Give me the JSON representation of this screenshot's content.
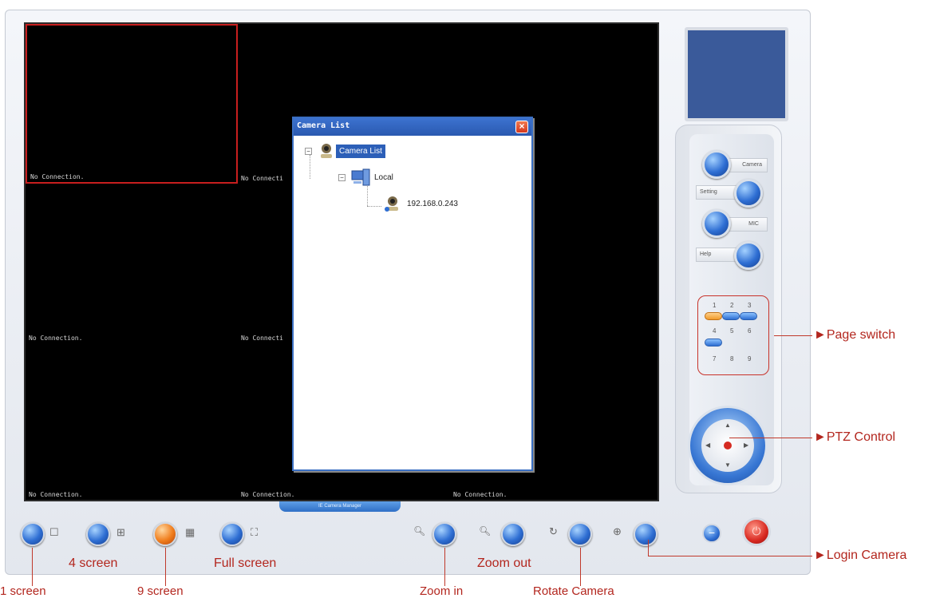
{
  "video": {
    "cells": [
      {
        "text": "No Connection."
      },
      {
        "text": "No Connecti"
      },
      {
        "text": "No Connection."
      },
      {
        "text": "No Connecti"
      },
      {
        "text": "No Connection."
      },
      {
        "text": "No Connection."
      },
      {
        "text": "No Connection."
      }
    ],
    "manager_tab": "IE Camera Manager"
  },
  "dialog": {
    "title": "Camera List",
    "close": "×",
    "tree": {
      "root": "Camera List",
      "group": "Local",
      "device": "192.168.0.243"
    }
  },
  "side_panel": {
    "buttons": [
      {
        "label": "Camera",
        "icon": "camera-button"
      },
      {
        "label": "Setting",
        "icon": "setting-button"
      },
      {
        "label": "MIC",
        "icon": "mic-button"
      },
      {
        "label": "Help",
        "icon": "help-button"
      }
    ],
    "page_numbers": [
      "1",
      "2",
      "3",
      "4",
      "5",
      "6",
      "7",
      "8",
      "9"
    ]
  },
  "toolbar": {
    "icons": [
      "one-screen",
      "four-screen",
      "nine-screen",
      "full-screen",
      "zoom-in",
      "zoom-out",
      "rotate",
      "login-camera",
      "minimize",
      "power"
    ]
  },
  "annotations": {
    "page_switch": "Page switch",
    "ptz_control": "PTZ Control",
    "login_camera": "Login Camera",
    "four_screen": "4 screen",
    "full_screen": "Full screen",
    "zoom_out": "Zoom out",
    "one_screen": "1 screen",
    "nine_screen": "9 screen",
    "zoom_in": "Zoom in",
    "rotate_camera": "Rotate Camera"
  },
  "colors": {
    "annotation": "#b3261e",
    "accent": "#2e6ed3",
    "selected_cell_border": "#c81e1e"
  }
}
